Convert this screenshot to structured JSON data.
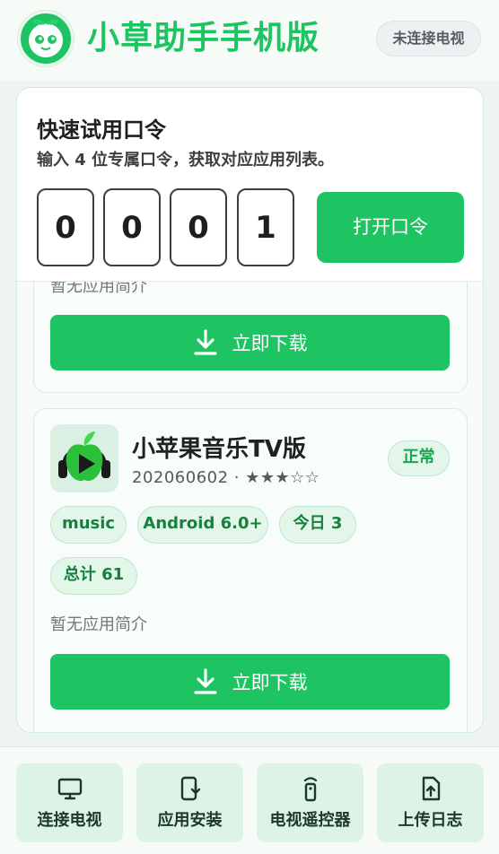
{
  "header": {
    "title": "小草助手手机版",
    "connection_status": "未连接电视",
    "logo_icon": "sprout-mascot-logo"
  },
  "quick_code": {
    "title": "快速试用口令",
    "subtitle": "输入 4 位专属口令，获取对应应用列表。",
    "digits": [
      "0",
      "0",
      "0",
      "1"
    ],
    "open_button": "打开口令"
  },
  "apps": [
    {
      "description": "暂无应用简介",
      "download_label": "立即下载"
    },
    {
      "name": "小苹果音乐TV版",
      "meta": "202060602 · ★★★☆☆",
      "status": "正常",
      "tags": [
        "music",
        "Android 6.0+",
        "今日 3",
        "总计 61"
      ],
      "description": "暂无应用简介",
      "download_label": "立即下载",
      "icon": "green-apple-headphones-play-icon"
    }
  ],
  "bottom_nav": [
    {
      "label": "连接电视",
      "icon": "tv-icon"
    },
    {
      "label": "应用安装",
      "icon": "phone-install-icon"
    },
    {
      "label": "电视遥控器",
      "icon": "remote-control-icon"
    },
    {
      "label": "上传日志",
      "icon": "upload-file-icon"
    }
  ],
  "colors": {
    "accent": "#1ec462",
    "background": "#eef5f0",
    "tag_bg": "#e2f6ea",
    "tag_text": "#16803f"
  }
}
